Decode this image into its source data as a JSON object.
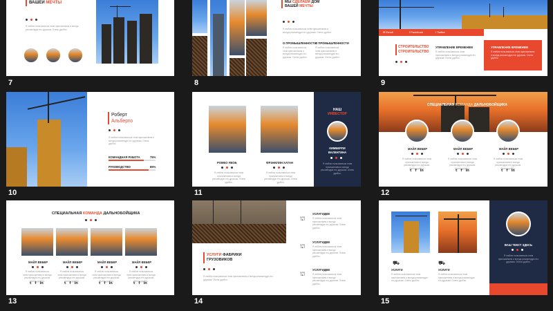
{
  "slides": [
    {
      "num": "7",
      "title_line1": "",
      "title_line2a": "ВАШЕЙ",
      "title_line2b": "МЕЧТЫ"
    },
    {
      "num": "8",
      "title_line1a": "МЫ",
      "title_line1b": "СДЕЛАЕМ",
      "title_line1c": "ДОМ",
      "title_line2a": "ВАШЕЙ",
      "title_line2b": "МЕЧТЫ",
      "col1": "О ПРОМЫШЛЕННОСТИ",
      "col2": "О ПРОМЫШЛЕННОСТИ"
    },
    {
      "num": "9",
      "social1": "Email",
      "social2": "Facebook",
      "social3": "Twitter",
      "title_a": "СТРОИТЕЛЬСТВО",
      "title_b": "СТРОИТЕЛЬСТВО",
      "col1": "УПРАВЛЕНИЕ ВРЕМЕНЕМ",
      "col2": "УПРАВЛЕНИЕ ВРЕМЕНЕМ"
    },
    {
      "num": "10",
      "name1": "Роберт",
      "name2": "Альберто",
      "skill1": "КОМАНДНАЯ РАБОТА",
      "skill1_val": "75%",
      "skill1_frac": 0.75,
      "skill2": "РУКОВОДСТВО",
      "skill2_val": "85%",
      "skill2_frac": 0.85
    },
    {
      "num": "11",
      "person1": "РОМЕО ЯКОБ",
      "person2": "ФРЭНКЛИН ХАТАН",
      "side_title1": "НАШ",
      "side_title2": "ИНВЕСТОР",
      "side_name1": "КИМБЕРЛИ",
      "side_name2": "ВАЛЕНТИНА"
    },
    {
      "num": "12",
      "title_a": "СПЕЦИАЛЬНАЯ",
      "title_b": "КОМАНДА",
      "title_c": "ДАЛЬНОБОЙЩИКА",
      "p1": "МАЙЛ ВЕБЕР",
      "p2": "МАЙЛ ВЕБЕР",
      "p3": "МАЙЛ ВЕБЕР"
    },
    {
      "num": "13",
      "title_a": "СПЕЦИАЛЬНАЯ",
      "title_b": "КОМАНДА",
      "title_c": "ДАЛЬНОБОЙЩИКА",
      "p1": "МАЙЛ ВЕБЕР",
      "p2": "МАЙЛ ВЕБЕР",
      "p3": "МАЙЛ ВЕБЕР",
      "p4": "МАЙЛ ВЕБЕР"
    },
    {
      "num": "14",
      "title_a": "УСЛУГИ",
      "title_b": "ФАБРИКИ",
      "title_c": "ГРУЗОВИКОВ",
      "svc1": "УСЛУГИДВЕ",
      "svc2": "УСЛУГИДВЕ",
      "svc3": "УСЛУГИДВЕ"
    },
    {
      "num": "15",
      "svc1": "УСЛУГИ",
      "svc2": "УСЛУГИ",
      "side_title": "ВАШ ТЕКСТ ЗДЕСЬ"
    }
  ],
  "lorem": "Я люблю пользоваться этим приложением и всегда рекомендую его друзьям. Очень удобно.",
  "colors": {
    "accent": "#e8492e",
    "navy": "#1f2a44",
    "bg": "#1a1a1a"
  }
}
